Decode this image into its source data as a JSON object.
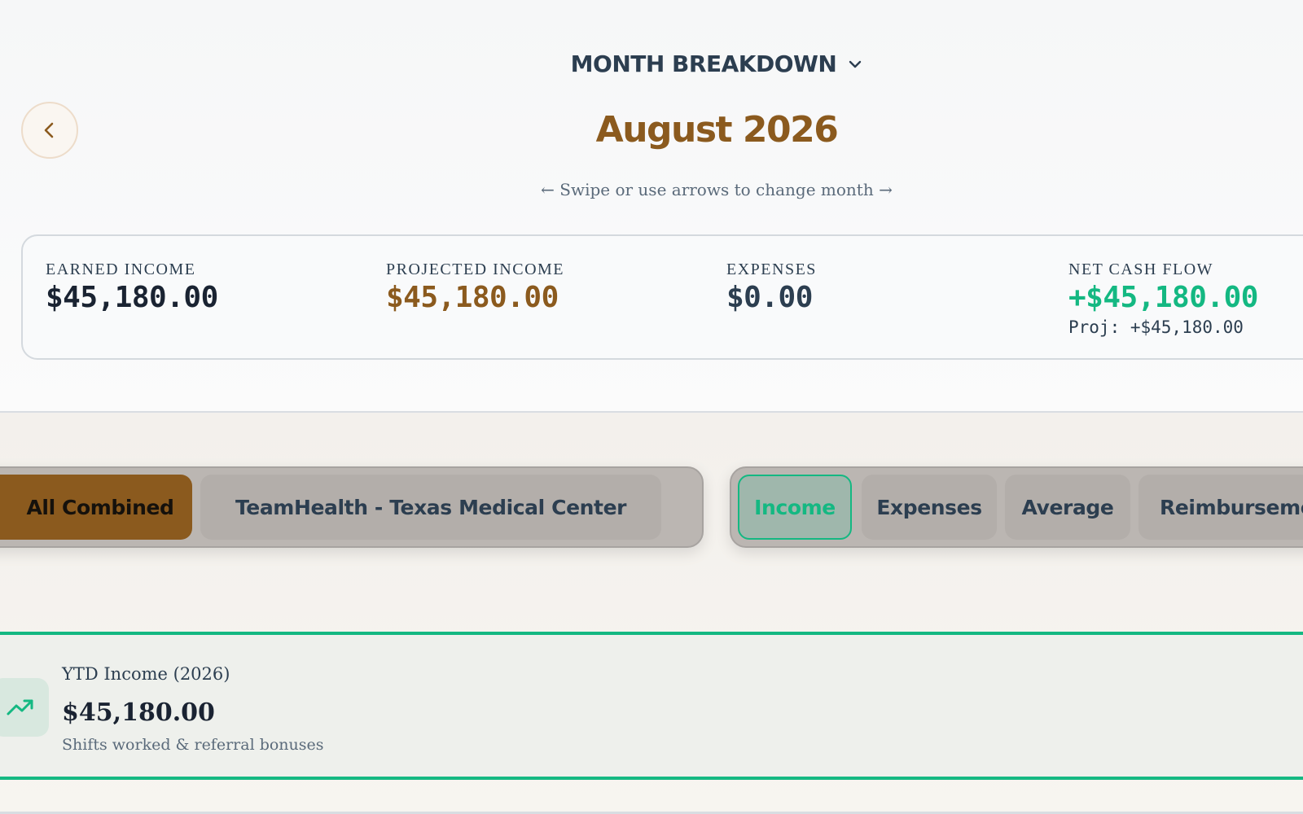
{
  "header": {
    "title": "MONTH BREAKDOWN",
    "month": "August 2026",
    "hint": "← Swipe or use arrows to change month →"
  },
  "summary": {
    "earned": {
      "label": "EARNED INCOME",
      "value": "$45,180.00"
    },
    "projected": {
      "label": "PROJECTED INCOME",
      "value": "$45,180.00"
    },
    "expenses": {
      "label": "EXPENSES",
      "value": "$0.00"
    },
    "net": {
      "label": "NET CASH FLOW",
      "value": "+$45,180.00",
      "proj": "Proj: +$45,180.00"
    }
  },
  "filters": {
    "source": [
      "All Combined",
      "TeamHealth - Texas Medical Center"
    ],
    "view": [
      "Income",
      "Expenses",
      "Average",
      "Reimbursements"
    ]
  },
  "ytd": {
    "title": "YTD Income (2026)",
    "amount": "$45,180.00",
    "subtitle": "Shifts worked & referral bonuses"
  },
  "colors": {
    "brand_brown": "#8b5a1e",
    "positive_green": "#14b882",
    "text_slate": "#2c3e50"
  },
  "icons": {
    "back": "chevron-left-icon",
    "dropdown": "chevron-down-icon",
    "ytd": "trending-up-icon"
  }
}
